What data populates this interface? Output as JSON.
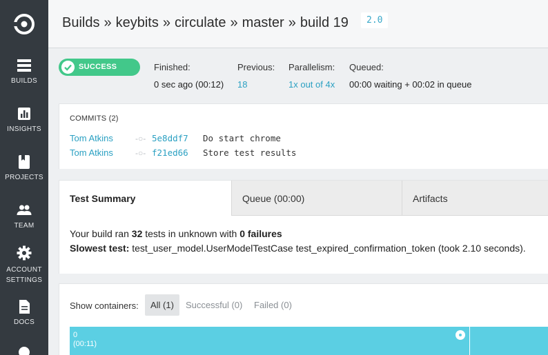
{
  "sidebar": {
    "items": [
      {
        "label": "BUILDS",
        "icon": "builds-icon"
      },
      {
        "label": "INSIGHTS",
        "icon": "insights-icon"
      },
      {
        "label": "PROJECTS",
        "icon": "projects-icon"
      },
      {
        "label": "TEAM",
        "icon": "team-icon"
      },
      {
        "label": "ACCOUNT",
        "label2": "SETTINGS",
        "icon": "gear-icon"
      },
      {
        "label": "DOCS",
        "icon": "docs-icon"
      }
    ]
  },
  "header": {
    "crumbs": [
      "Builds",
      "keybits",
      "circulate",
      "master",
      "build 19"
    ],
    "separator": "»",
    "version": "2.0"
  },
  "build": {
    "status": "SUCCESS",
    "finished_label": "Finished:",
    "finished_value": "0 sec ago (00:12)",
    "previous_label": "Previous:",
    "previous_value": "18",
    "parallelism_label": "Parallelism:",
    "parallelism_value": "1x out of 4x",
    "queued_label": "Queued:",
    "queued_value": "00:00 waiting + 00:02 in queue"
  },
  "commits": {
    "title": "COMMITS (2)",
    "rows": [
      {
        "author": "Tom Atkins",
        "sha": "5e8ddf7",
        "message": "Do start chrome"
      },
      {
        "author": "Tom Atkins",
        "sha": "f21ed66",
        "message": "Store test results"
      }
    ]
  },
  "tabs": [
    {
      "label": "Test Summary"
    },
    {
      "label": "Queue (00:00)"
    },
    {
      "label": "Artifacts"
    }
  ],
  "summary": {
    "line1_prefix": "Your build ran",
    "tests_count": "32",
    "line1_middle": "tests in unknown with",
    "failures": "0 failures",
    "slowest_label": "Slowest test:",
    "slowest_value": "test_user_model.UserModelTestCase test_expired_confirmation_token (took 2.10 seconds)."
  },
  "containers": {
    "show_label": "Show containers:",
    "filters": [
      "All (1)",
      "Successful (0)",
      "Failed (0)"
    ],
    "bar": {
      "index": "0",
      "duration": "(00:11)"
    }
  },
  "colors": {
    "sidebar_bg": "#343a40",
    "success": "#42c88a",
    "link": "#2aa0c2",
    "container_bar": "#5bcfe3"
  }
}
